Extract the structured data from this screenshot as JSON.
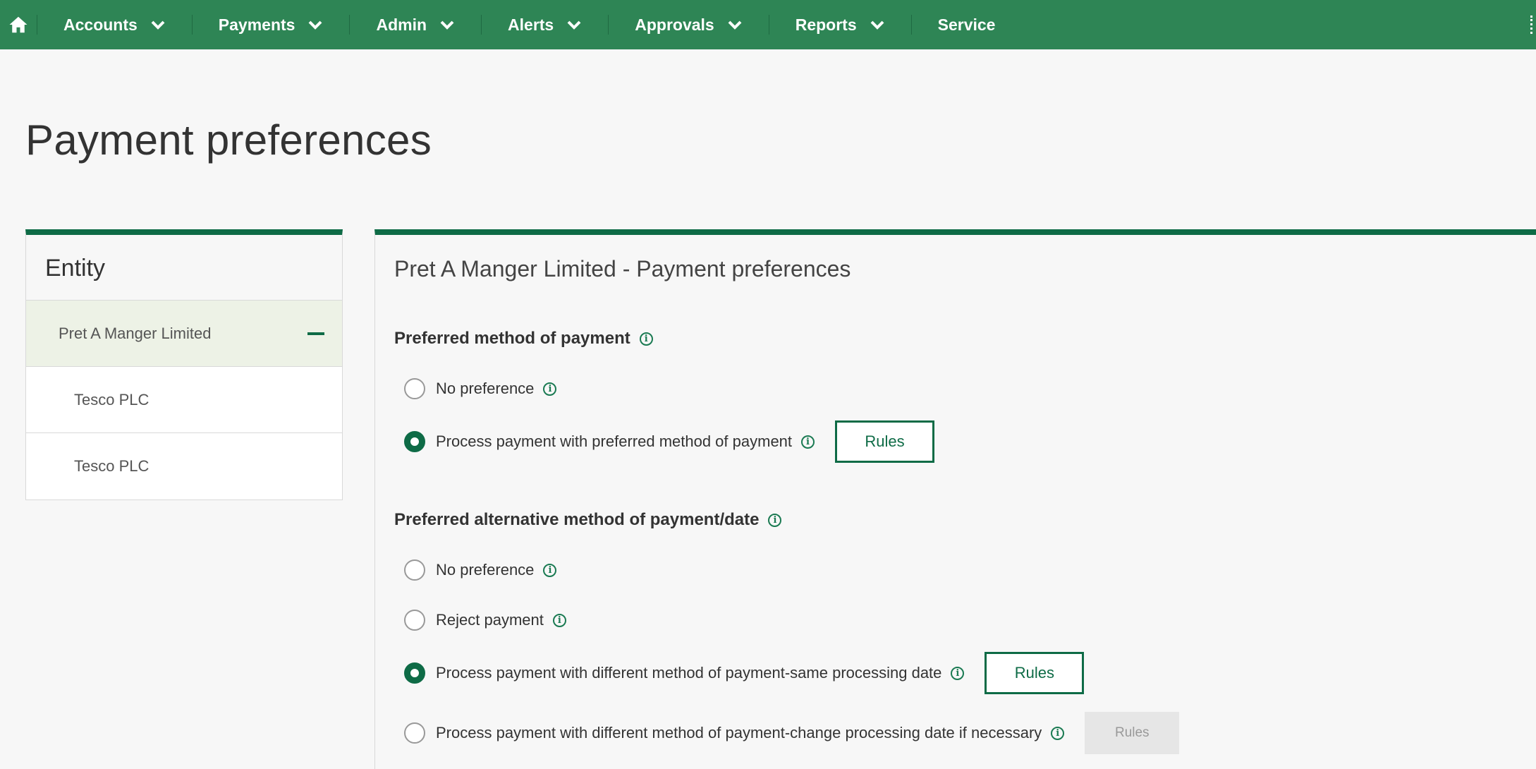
{
  "nav": {
    "items": [
      {
        "label": "Accounts",
        "dropdown": true
      },
      {
        "label": "Payments",
        "dropdown": true
      },
      {
        "label": "Admin",
        "dropdown": true
      },
      {
        "label": "Alerts",
        "dropdown": true
      },
      {
        "label": "Approvals",
        "dropdown": true
      },
      {
        "label": "Reports",
        "dropdown": true
      },
      {
        "label": "Service",
        "dropdown": false
      }
    ],
    "color": "#2e8555"
  },
  "page": {
    "title": "Payment preferences"
  },
  "entity": {
    "heading": "Entity",
    "items": [
      {
        "label": "Pret A Manger Limited",
        "selected": true
      },
      {
        "label": "Tesco PLC",
        "selected": false
      },
      {
        "label": "Tesco PLC",
        "selected": false
      }
    ]
  },
  "panel": {
    "title": "Pret A Manger Limited - Payment preferences",
    "preferred": {
      "title": "Preferred method of payment",
      "options": [
        {
          "label": "No preference",
          "checked": false
        },
        {
          "label": "Process payment with preferred method of payment",
          "checked": true,
          "rules": "Rules"
        }
      ]
    },
    "alternative": {
      "title": "Preferred alternative method of payment/date",
      "options": [
        {
          "label": "No preference",
          "checked": false
        },
        {
          "label": "Reject payment",
          "checked": false
        },
        {
          "label": "Process payment with different method of payment-same processing date",
          "checked": true,
          "rules": "Rules"
        },
        {
          "label": "Process payment with different method of payment-change processing date if necessary",
          "checked": false,
          "rules": "Rules",
          "rules_disabled": true
        }
      ]
    }
  },
  "colors": {
    "accent": "#0e6b46",
    "nav": "#2e8555",
    "selected_row": "#edf2e6"
  }
}
